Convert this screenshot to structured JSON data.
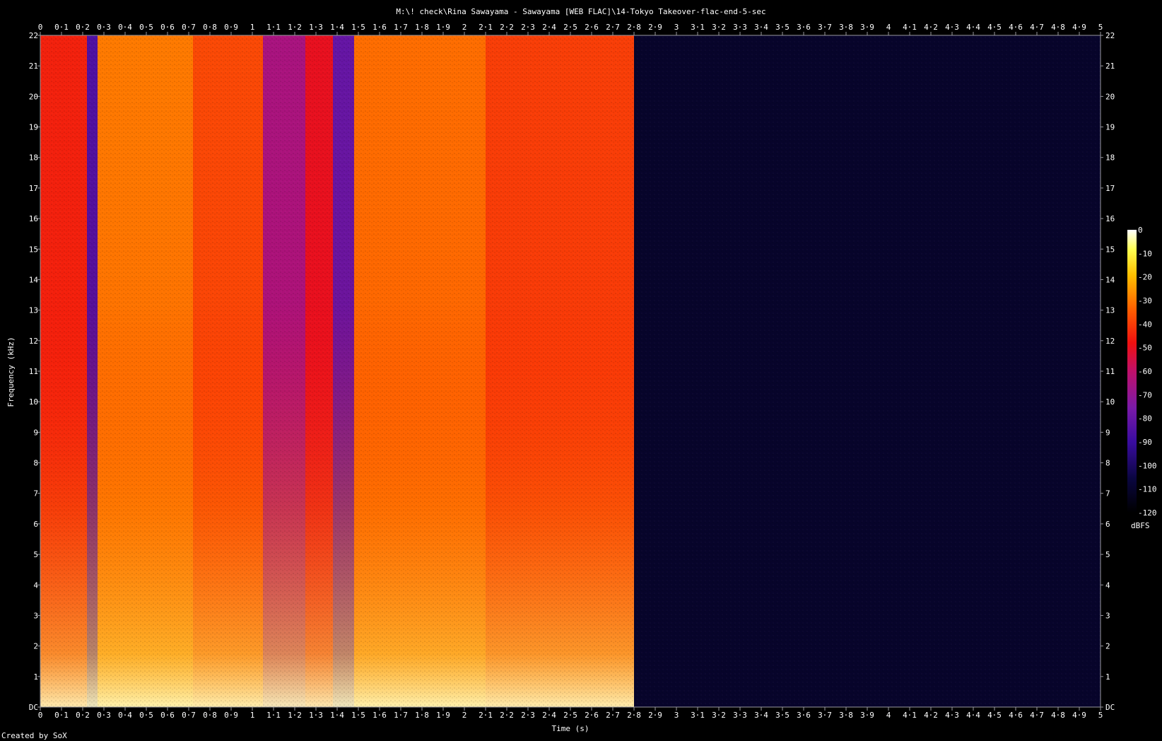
{
  "chart_data": {
    "type": "heatmap",
    "title": "M:\\! check\\Rina Sawayama - Sawayama [WEB FLAC]\\14-Tokyo Takeover-flac-end-5-sec",
    "xlabel": "Time (s)",
    "ylabel": "Frequency (kHz)",
    "xlim": [
      0,
      5
    ],
    "ylim": [
      0,
      22
    ],
    "x_ticks": [
      "0",
      "0·1",
      "0·2",
      "0·3",
      "0·4",
      "0·5",
      "0·6",
      "0·7",
      "0·8",
      "0·9",
      "1",
      "1·1",
      "1·2",
      "1·3",
      "1·4",
      "1·5",
      "1·6",
      "1·7",
      "1·8",
      "1·9",
      "2",
      "2·1",
      "2·2",
      "2·3",
      "2·4",
      "2·5",
      "2·6",
      "2·7",
      "2·8",
      "2·9",
      "3",
      "3·1",
      "3·2",
      "3·3",
      "3·4",
      "3·5",
      "3·6",
      "3·7",
      "3·8",
      "3·9",
      "4",
      "4·1",
      "4·2",
      "4·3",
      "4·4",
      "4·5",
      "4·6",
      "4·7",
      "4·8",
      "4·9",
      "5"
    ],
    "y_ticks": [
      "DC",
      "1",
      "2",
      "3",
      "4",
      "5",
      "6",
      "7",
      "8",
      "9",
      "10",
      "11",
      "12",
      "13",
      "14",
      "15",
      "16",
      "17",
      "18",
      "19",
      "20",
      "21",
      "22"
    ],
    "colorbar": {
      "label": "dBFS",
      "ticks": [
        "0",
        "-10",
        "-20",
        "-30",
        "-40",
        "-50",
        "-60",
        "-70",
        "-80",
        "-90",
        "-100",
        "-110",
        "-120"
      ],
      "range": [
        -120,
        0
      ]
    },
    "segments": [
      {
        "t_start": 0.0,
        "t_end": 0.22,
        "level_db": -45
      },
      {
        "t_start": 0.22,
        "t_end": 0.27,
        "level_db": -85
      },
      {
        "t_start": 0.27,
        "t_end": 0.72,
        "level_db": -30
      },
      {
        "t_start": 0.72,
        "t_end": 1.05,
        "level_db": -38
      },
      {
        "t_start": 1.05,
        "t_end": 1.25,
        "level_db": -65
      },
      {
        "t_start": 1.25,
        "t_end": 1.38,
        "level_db": -50
      },
      {
        "t_start": 1.38,
        "t_end": 1.48,
        "level_db": -80
      },
      {
        "t_start": 1.48,
        "t_end": 2.1,
        "level_db": -32
      },
      {
        "t_start": 2.1,
        "t_end": 2.8,
        "level_db": -40
      },
      {
        "t_start": 2.8,
        "t_end": 5.0,
        "level_db": -110
      }
    ],
    "footer": "Created by SoX"
  }
}
